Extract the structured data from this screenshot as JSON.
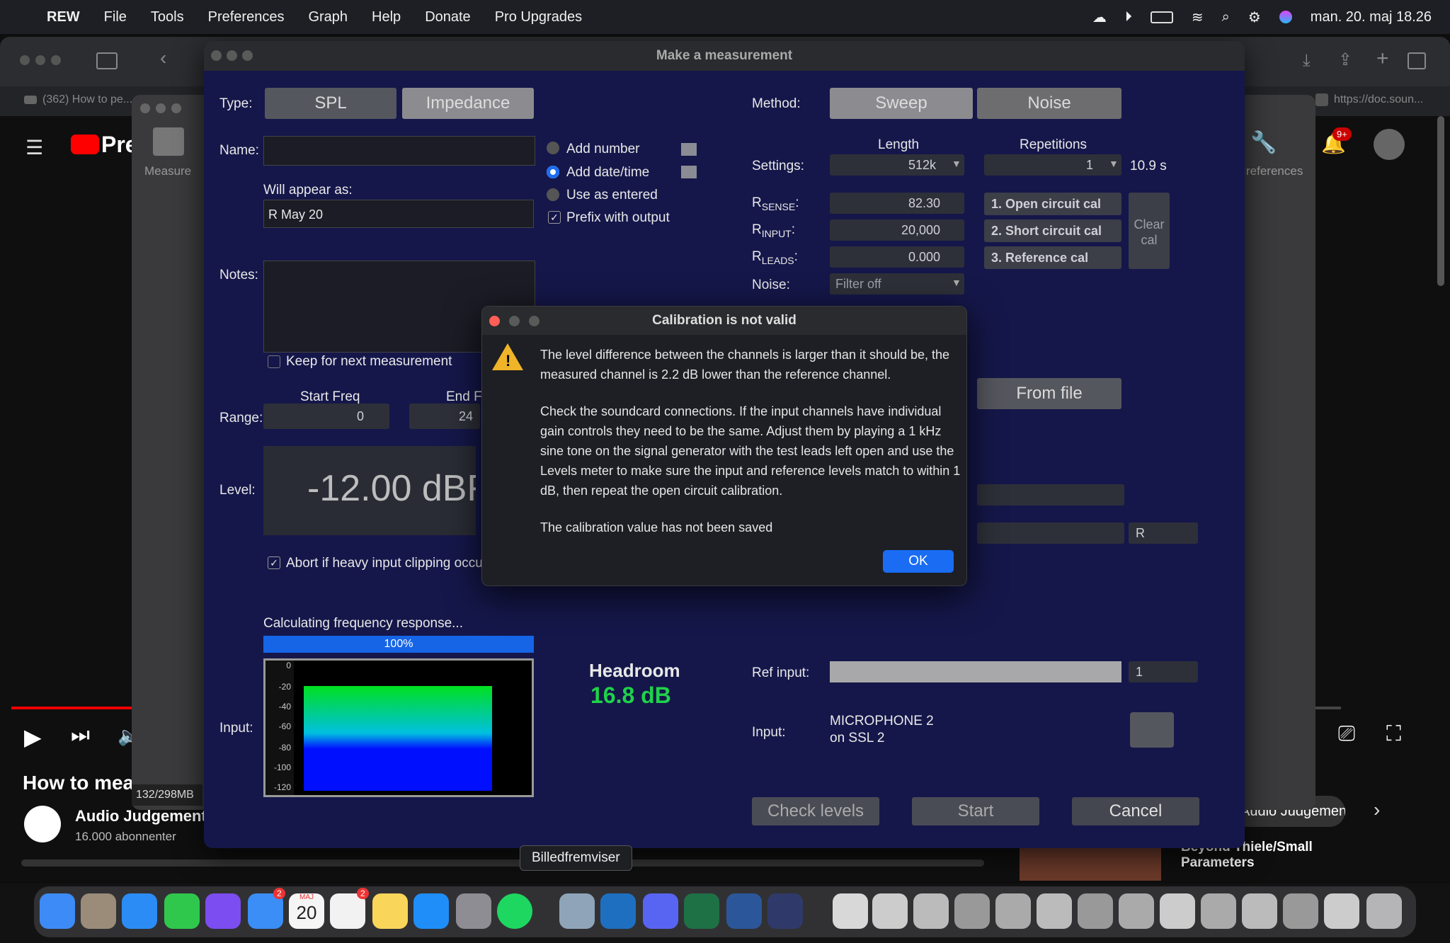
{
  "menubar": {
    "apple": "",
    "app": "REW",
    "items": [
      "File",
      "Tools",
      "Preferences",
      "Graph",
      "Help",
      "Donate",
      "Pro Upgrades"
    ],
    "datetime": "man. 20. maj 18.26"
  },
  "browser": {
    "tab1": "(362) How to pe...",
    "url": "https://doc.soun...",
    "notif_count": "9+",
    "video_title": "How to meas",
    "channel": "Audio Judgement",
    "subscribers": "16.000 abonnenter",
    "side_item": "Audio Judgement",
    "side_item2": "Beyond Thiele/Small",
    "side_item3": "Parameters"
  },
  "rew_main": {
    "measure_label": "Measure",
    "preferences_label": "references",
    "memory": "132/298MB"
  },
  "dialog": {
    "title": "Make a measurement",
    "type_label": "Type:",
    "type_options": [
      "SPL",
      "Impedance"
    ],
    "method_label": "Method:",
    "method_options": [
      "Sweep",
      "Noise"
    ],
    "name_label": "Name:",
    "name_value": "",
    "add_number": "Add number",
    "add_datetime": "Add date/time",
    "use_as_entered": "Use as entered",
    "prefix_output": "Prefix with output",
    "will_appear_label": "Will appear as:",
    "will_appear_value": "R May 20",
    "notes_label": "Notes:",
    "keep_next": "Keep for next measurement",
    "start_freq_label": "Start Freq",
    "end_freq_label": "End F",
    "range_label": "Range:",
    "start_freq_value": "0",
    "end_freq_value": "24",
    "level_label": "Level:",
    "level_value": "-12.00 dBF",
    "abort_clipping": "Abort if heavy input clipping occu",
    "length_label": "Length",
    "repetitions_label": "Repetitions",
    "settings_label": "Settings:",
    "length_value": "512k",
    "repetitions_value": "1",
    "duration": "10.9 s",
    "rsense_label": "R",
    "rsense_sub": "SENSE",
    "rsense_value": "82.30",
    "rinput_label": "R",
    "rinput_sub": "INPUT",
    "rinput_value": "20,000",
    "rleads_label": "R",
    "rleads_sub": "LEADS",
    "rleads_value": "0.000",
    "cal_buttons": [
      "1. Open circuit cal",
      "2. Short circuit cal",
      "3. Reference cal"
    ],
    "clear_cal": "Clear cal",
    "noise_label": "Noise:",
    "noise_value": "Filter off",
    "from_file": "From file",
    "output_channel": "R",
    "progress_label": "Calculating frequency response...",
    "progress_value": "100%",
    "headroom_label": "Headroom",
    "headroom_value": "16.8 dB",
    "ref_input_label": "Ref input:",
    "ref_input_channel": "1",
    "input_label_left": "Input:",
    "input_label": "Input:",
    "input_device_line1": "MICROPHONE 2",
    "input_device_line2": "on SSL 2",
    "meter_ticks": [
      "0",
      "-20",
      "-40",
      "-60",
      "-80",
      "-100",
      "-120"
    ],
    "buttons": {
      "check_levels": "Check levels",
      "start": "Start",
      "cancel": "Cancel"
    }
  },
  "alert": {
    "title": "Calibration is not valid",
    "p1": "The level difference between the channels is larger than it should be, the measured channel is 2.2 dB lower than the reference channel.",
    "p2": "Check the soundcard connections. If the input channels have individual gain controls they need to be the same. Adjust them by playing a 1 kHz sine tone on the signal generator with the test leads left open and use the Levels meter to make sure the input and reference levels match to within 1 dB, then repeat the open circuit calibration.",
    "p3": "The calibration value has not been saved",
    "ok": "OK"
  },
  "dock": {
    "tooltip": "Billedfremviser",
    "calendar_month": "MAJ",
    "calendar_day": "20",
    "badge_mail": "2",
    "badge_reminders": "2"
  }
}
